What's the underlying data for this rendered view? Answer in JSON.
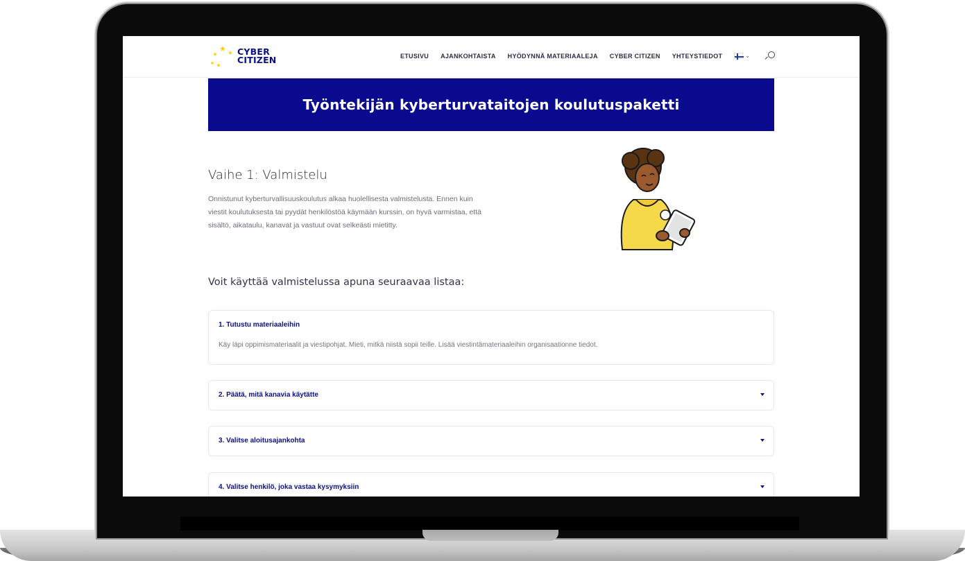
{
  "header": {
    "logo_text": "CYBER\nCITIZEN",
    "nav": [
      {
        "label": "ETUSIVU"
      },
      {
        "label": "AJANKOHTAISTA"
      },
      {
        "label": "HYÖDYNNÄ MATERIAALEJA"
      },
      {
        "label": "CYBER CITIZEN"
      },
      {
        "label": "YHTEYSTIEDOT"
      }
    ],
    "language_icon": "finnish-flag-icon",
    "search_icon": "search-icon"
  },
  "banner": {
    "title": "Työntekijän kyberturvataitojen koulutuspaketti"
  },
  "section": {
    "title": "Vaihe 1: Valmistelu",
    "intro": "Onnistunut kyberturvallisuuskoulutus alkaa huolellisesta valmistelusta. Ennen kuin viestit koulutuksesta tai pyydät henkilöstöä käymään kurssin, on hyvä varmistaa, että sisältö, aikataulu, kanavat ja vastuut ovat selkeästi mietitty.",
    "list_intro": "Voit käyttää valmistelussa apuna seuraavaa listaa:"
  },
  "accordion": [
    {
      "title": "1. Tutustu materiaaleihin",
      "body": "Käy läpi oppimismateriaalit ja viestipohjat. Mieti, mitkä niistä sopii teille. Lisää viestintämateriaaleihin organisaationne tiedot.",
      "expanded": true
    },
    {
      "title": "2. Päätä, mitä kanavia käytätte",
      "expanded": false
    },
    {
      "title": "3. Valitse aloitusajankohta",
      "expanded": false
    },
    {
      "title": "4. Valitse henkilö, joka vastaa kysymyksiin",
      "expanded": false
    }
  ],
  "colors": {
    "brand_navy": "#0a0a8f",
    "accent_yellow": "#f5d000"
  }
}
